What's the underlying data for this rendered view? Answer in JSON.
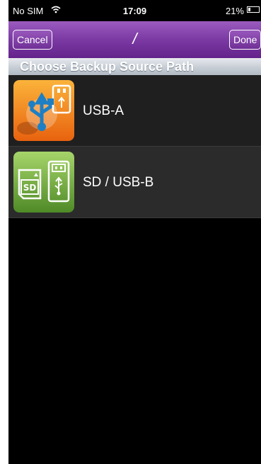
{
  "status_bar": {
    "carrier": "No SIM",
    "time": "17:09",
    "battery": "21%",
    "battery_level": 0.21,
    "wifi_icon": "wifi-icon",
    "battery_icon": "battery-icon"
  },
  "nav": {
    "cancel_label": "Cancel",
    "title": "/",
    "done_label": "Done",
    "accent_color": "#7b3aa3"
  },
  "section_header": "Choose Backup Source Path",
  "sources": [
    {
      "label": "USB-A",
      "icon": "usb-drive-icon",
      "icon_color": "#f07d16"
    },
    {
      "label": "SD / USB-B",
      "icon": "sd-card-icon",
      "icon_color": "#6aa23a"
    }
  ]
}
